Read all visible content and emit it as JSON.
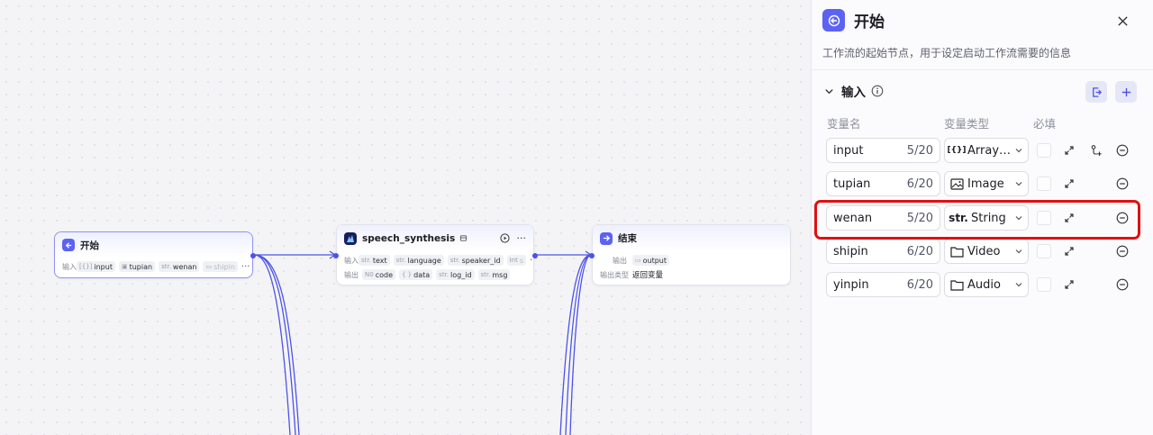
{
  "canvas": {
    "start_node": {
      "title": "开始",
      "input_label": "输入",
      "inputs": [
        {
          "type": "[{}]",
          "name": "input"
        },
        {
          "type": "img",
          "name": "tupian"
        },
        {
          "type": "str.",
          "name": "wenan"
        },
        {
          "type": "dir",
          "name": "shipin"
        }
      ],
      "more": "···"
    },
    "speech_node": {
      "title": "speech_synthesis",
      "input_label": "输入",
      "output_label": "输出",
      "inputs": [
        {
          "type": "str.",
          "name": "text"
        },
        {
          "type": "str.",
          "name": "language"
        },
        {
          "type": "str.",
          "name": "speaker_id"
        },
        {
          "type": "Int",
          "name": "s"
        }
      ],
      "outputs": [
        {
          "type": "N0",
          "name": "code"
        },
        {
          "type": "{ }",
          "name": "data"
        },
        {
          "type": "str.",
          "name": "log_id"
        },
        {
          "type": "str.",
          "name": "msg"
        }
      ],
      "more": "···",
      "row_more": "···"
    },
    "end_node": {
      "title": "结束",
      "output_label": "输出",
      "output_name": "output",
      "type_label": "输出类型",
      "type_value": "返回变量"
    },
    "edge_color": "#4d53e8"
  },
  "panel": {
    "title": "开始",
    "description": "工作流的起始节点，用于设定启动工作流需要的信息",
    "section_title": "输入",
    "columns": {
      "name": "变量名",
      "type": "变量类型",
      "required": "必填"
    },
    "variables": [
      {
        "name": "input",
        "count": "5/20",
        "type": "Array…",
        "type_icon": "array-object-icon"
      },
      {
        "name": "tupian",
        "count": "6/20",
        "type": "Image",
        "type_icon": "image-icon"
      },
      {
        "name": "wenan",
        "count": "5/20",
        "type": "String",
        "type_icon": "string-icon"
      },
      {
        "name": "shipin",
        "count": "6/20",
        "type": "Video",
        "type_icon": "folder-icon"
      },
      {
        "name": "yinpin",
        "count": "6/20",
        "type": "Audio",
        "type_icon": "folder-icon"
      }
    ],
    "string_glyph": "str.",
    "array_glyph": "[{}]",
    "accent_color": "#5c62f2",
    "highlight_color": "#e01010"
  }
}
